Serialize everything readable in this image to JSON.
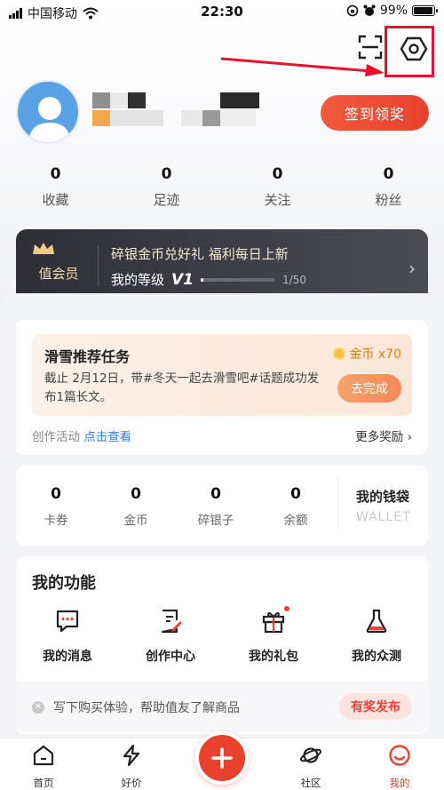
{
  "status_bar": {
    "carrier": "中国移动",
    "time": "22:30",
    "battery": "99%"
  },
  "header": {
    "icons": [
      "scan-icon",
      "settings-icon"
    ],
    "checkin_label": "签到领奖"
  },
  "stats": [
    {
      "value": "0",
      "label": "收藏"
    },
    {
      "value": "0",
      "label": "足迹"
    },
    {
      "value": "0",
      "label": "关注"
    },
    {
      "value": "0",
      "label": "粉丝"
    }
  ],
  "vip": {
    "badge": "值会员",
    "promo": "碎银金币兑好礼 福利每日上新",
    "level_label": "我的等级",
    "level": "V1",
    "progress_text": "1/50",
    "progress_fraction": 0.02
  },
  "task": {
    "title": "滑雪推荐任务",
    "coin_reward": "金币 x70",
    "description": "截止 2月12日，带#冬天一起去滑雪吧#话题成功发布1篇长文。",
    "action": "去完成",
    "foot_label": "创作活动",
    "foot_link": "点击查看",
    "more": "更多奖励 ›"
  },
  "wallet": {
    "items": [
      {
        "value": "0",
        "label": "卡券"
      },
      {
        "value": "0",
        "label": "金币"
      },
      {
        "value": "0",
        "label": "碎银子"
      },
      {
        "value": "0",
        "label": "余额"
      }
    ],
    "title": "我的钱袋",
    "subtitle": "WALLET"
  },
  "functions": {
    "title": "我的功能",
    "items": [
      {
        "label": "我的消息",
        "icon": "message-icon"
      },
      {
        "label": "创作中心",
        "icon": "create-icon"
      },
      {
        "label": "我的礼包",
        "icon": "gift-icon"
      },
      {
        "label": "我的众测",
        "icon": "flask-icon"
      }
    ]
  },
  "tip": {
    "text": "写下购买体验，帮助值友了解商品",
    "button": "有奖发布"
  },
  "tabbar": [
    {
      "label": "首页",
      "icon": "home-icon"
    },
    {
      "label": "好价",
      "icon": "bolt-icon"
    },
    {
      "label": "",
      "icon": "plus-icon"
    },
    {
      "label": "社区",
      "icon": "planet-icon"
    },
    {
      "label": "我的",
      "icon": "profile-icon",
      "active": true
    }
  ],
  "colors": {
    "accent": "#e8412d",
    "annotation": "#e8132b",
    "vip_bg": "#2e2f37"
  }
}
